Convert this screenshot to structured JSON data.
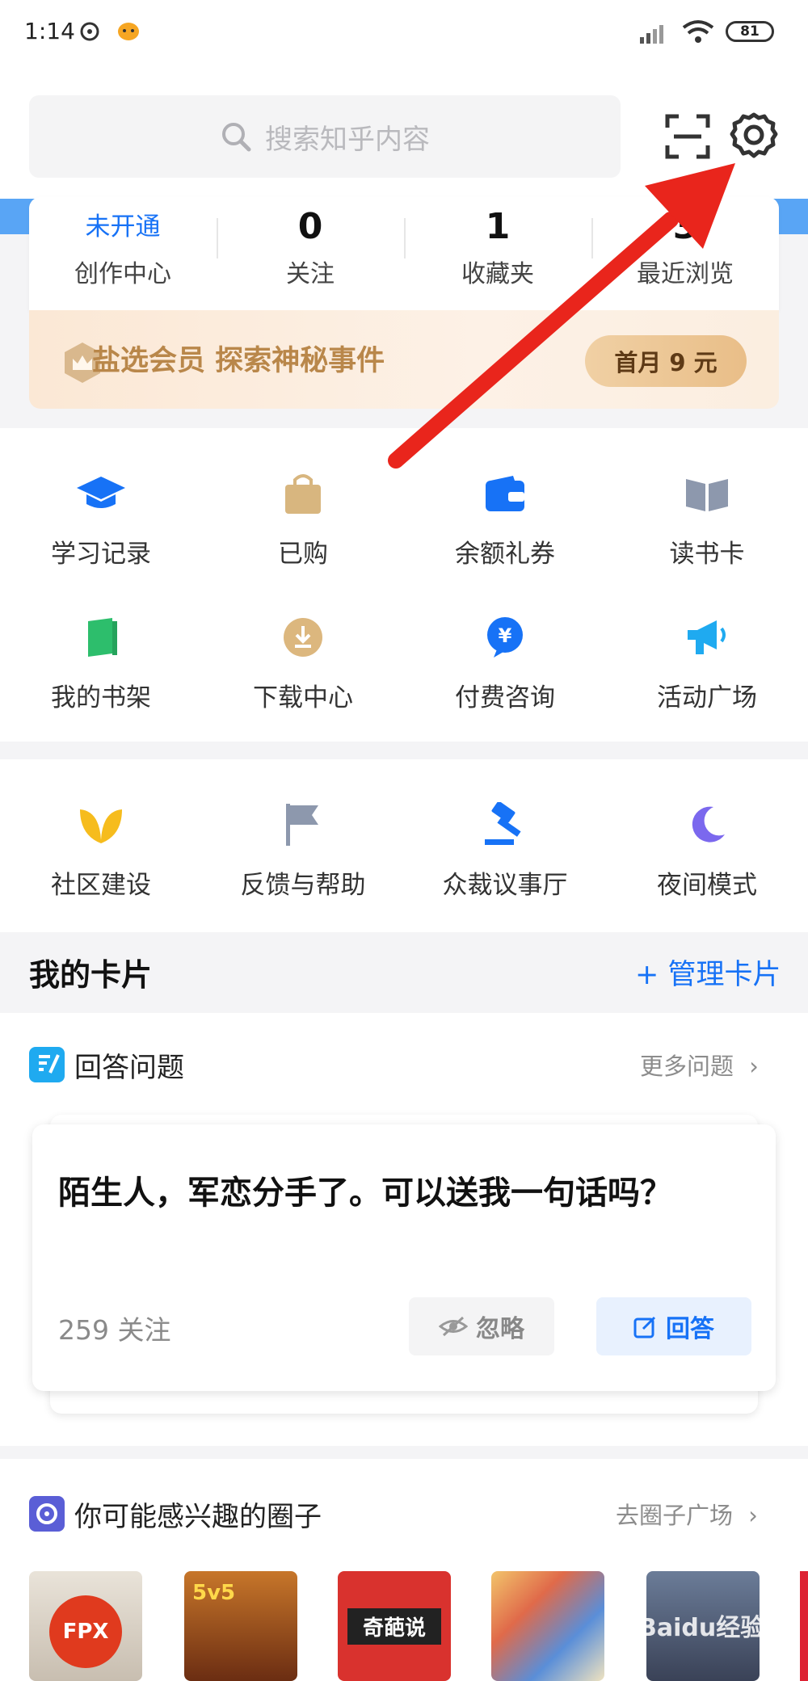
{
  "status_bar": {
    "time": "1:14",
    "battery": "81"
  },
  "search": {
    "placeholder": "搜索知乎内容"
  },
  "stats": [
    {
      "value": "未开通",
      "label": "创作中心"
    },
    {
      "value": "0",
      "label": "关注"
    },
    {
      "value": "1",
      "label": "收藏夹"
    },
    {
      "value": "3",
      "label": "最近浏览"
    }
  ],
  "vip": {
    "text": "盐选会员 探索神秘事件",
    "button": "首月 9 元"
  },
  "grid1": [
    {
      "label": "学习记录",
      "icon": "graduation-cap-icon"
    },
    {
      "label": "已购",
      "icon": "shopping-bag-icon"
    },
    {
      "label": "余额礼券",
      "icon": "wallet-icon"
    },
    {
      "label": "读书卡",
      "icon": "open-book-icon"
    },
    {
      "label": "我的书架",
      "icon": "bookshelf-icon"
    },
    {
      "label": "下载中心",
      "icon": "download-icon"
    },
    {
      "label": "付费咨询",
      "icon": "paid-consult-icon"
    },
    {
      "label": "活动广场",
      "icon": "megaphone-icon"
    }
  ],
  "grid2": [
    {
      "label": "社区建设",
      "icon": "sprout-icon"
    },
    {
      "label": "反馈与帮助",
      "icon": "flag-icon"
    },
    {
      "label": "众裁议事厅",
      "icon": "gavel-icon"
    },
    {
      "label": "夜间模式",
      "icon": "moon-icon"
    }
  ],
  "my_cards": {
    "title": "我的卡片",
    "manage": "+ 管理卡片"
  },
  "answer_section": {
    "title": "回答问题",
    "more": "更多问题",
    "question": "陌生人，军恋分手了。可以送我一句话吗？",
    "followers": "259 关注",
    "ignore": "忽略",
    "answer": "回答"
  },
  "circles": {
    "title": "你可能感兴趣的圈子",
    "more": "去圈子广场",
    "items": [
      "FPX",
      "5v5",
      "奇葩说",
      "",
      ""
    ]
  },
  "watermark": "Baidu经验",
  "colors": {
    "accent": "#1772f6",
    "vip_text": "#b9874a",
    "arrow": "#e9251c"
  }
}
